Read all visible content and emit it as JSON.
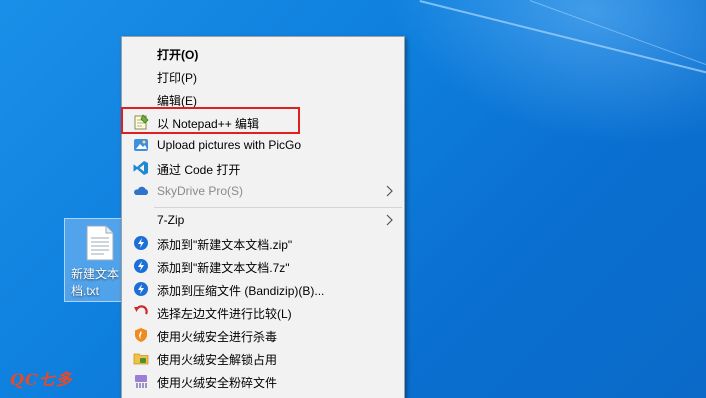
{
  "colors": {
    "desktop_bg": "#0e7fdd",
    "menu_bg": "#f2f2f2",
    "highlight_border": "#e02020"
  },
  "desktop": {
    "file": {
      "name": "新建文本\n档.txt",
      "icon": "text-document-icon"
    }
  },
  "context_menu": {
    "items": [
      {
        "label": "打开(O)",
        "bold": true,
        "icon": ""
      },
      {
        "label": "打印(P)",
        "icon": ""
      },
      {
        "label": "编辑(E)",
        "icon": ""
      },
      {
        "label": "以 Notepad++ 编辑",
        "icon": "notepadplusplus-icon",
        "highlighted": true
      },
      {
        "label": "Upload pictures with PicGo",
        "icon": "picgo-icon"
      },
      {
        "label": "通过 Code 打开",
        "icon": "vscode-icon"
      },
      {
        "label": "SkyDrive Pro(S)",
        "icon": "skydrive-cloud-icon",
        "disabled": true,
        "submenu": true
      },
      {
        "label": "7-Zip",
        "icon": "",
        "submenu": true
      },
      {
        "label": "添加到\"新建文本文档.zip\"",
        "icon": "bandizip-icon"
      },
      {
        "label": "添加到\"新建文本文档.7z\"",
        "icon": "bandizip-icon"
      },
      {
        "label": "添加到压缩文件 (Bandizip)(B)...",
        "icon": "bandizip-icon"
      },
      {
        "label": "选择左边文件进行比较(L)",
        "icon": "compare-arrow-icon"
      },
      {
        "label": "使用火绒安全进行杀毒",
        "icon": "huorong-shield-icon"
      },
      {
        "label": "使用火绒安全解锁占用",
        "icon": "folder-unlock-icon"
      },
      {
        "label": "使用火绒安全粉碎文件",
        "icon": "shredder-icon"
      }
    ]
  },
  "watermark": "QC七多"
}
